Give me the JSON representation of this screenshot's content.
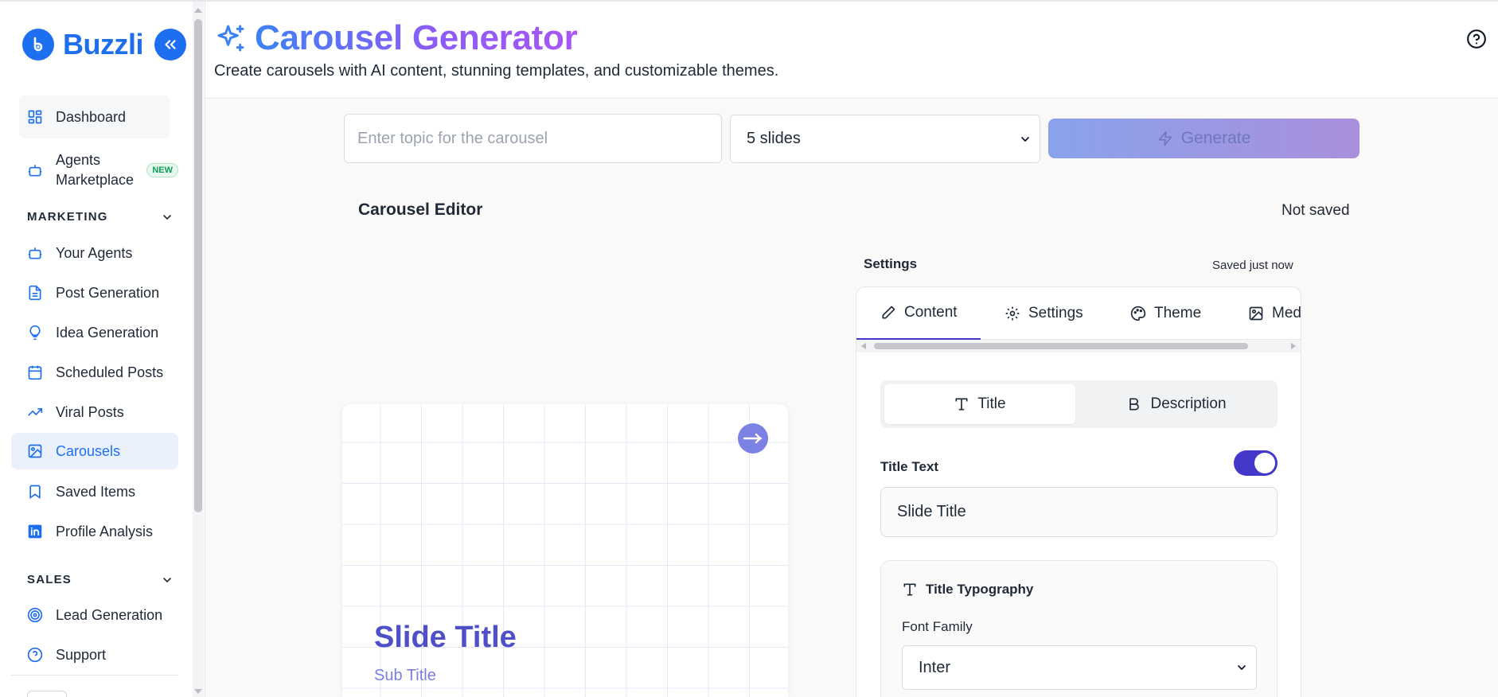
{
  "sidebar": {
    "brand": "Buzzli",
    "items": [
      {
        "label": "Dashboard"
      },
      {
        "label": "Agents Marketplace",
        "badge": "NEW"
      },
      {
        "label": "Your Agents"
      },
      {
        "label": "Post Generation"
      },
      {
        "label": "Idea Generation"
      },
      {
        "label": "Scheduled Posts"
      },
      {
        "label": "Viral Posts"
      },
      {
        "label": "Carousels",
        "active": true
      },
      {
        "label": "Saved Items"
      },
      {
        "label": "Profile Analysis"
      },
      {
        "label": "Lead Generation"
      },
      {
        "label": "Support"
      }
    ],
    "sections": {
      "marketing": "MARKETING",
      "sales": "SALES"
    }
  },
  "header": {
    "title": "Carousel Generator",
    "subtitle": "Create carousels with AI content, stunning templates, and customizable themes."
  },
  "generator": {
    "topic_placeholder": "Enter topic for the carousel",
    "slides_value": "5 slides",
    "generate_label": "Generate"
  },
  "editor": {
    "title": "Carousel Editor",
    "status": "Not saved",
    "slide": {
      "title": "Slide Title",
      "subtitle": "Sub Title"
    }
  },
  "settings_panel": {
    "label": "Settings",
    "saved_status": "Saved just now",
    "tabs": [
      {
        "label": "Content",
        "active": true
      },
      {
        "label": "Settings"
      },
      {
        "label": "Theme"
      },
      {
        "label": "Med"
      }
    ],
    "segment": {
      "title": "Title",
      "description": "Description"
    },
    "title_text_label": "Title Text",
    "title_text_enabled": true,
    "title_text_value": "Slide Title",
    "typography": {
      "heading": "Title Typography",
      "font_family_label": "Font Family",
      "font_family_value": "Inter"
    }
  },
  "colors": {
    "brand": "#1d6ff0",
    "accent": "#4338ca",
    "slide_title": "#4f4fc8"
  }
}
